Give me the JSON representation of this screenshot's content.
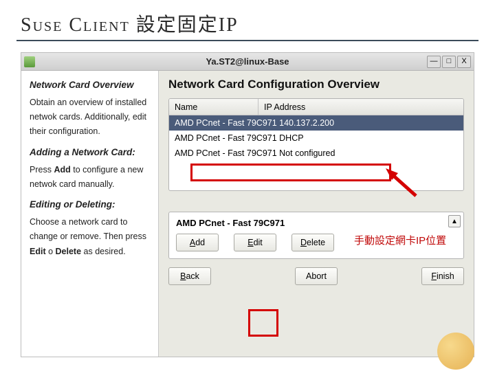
{
  "slide": {
    "title": "Suse Client 設定固定IP"
  },
  "window": {
    "title": "Ya.ST2@linux-Base",
    "controls": {
      "min": "—",
      "max": "□",
      "close": "X"
    }
  },
  "leftpane": {
    "h1": "Network Card Overview",
    "p1": "Obtain an overview of installed netwok cards. Additionally, edit their configuration.",
    "h2": "Adding a Network Card:",
    "p2a": "Press ",
    "p2b": "Add",
    "p2c": " to configure a new netwok card manually.",
    "h3": "Editing or Deleting:",
    "p3a": "Choose a network card to change or remove. Then press ",
    "p3b": "Edit",
    "p3c": " o ",
    "p3d": "Delete",
    "p3e": " as desired."
  },
  "rightpane": {
    "title": "Network Card Configuration Overview",
    "col_name": "Name",
    "col_ip": "IP Address",
    "rows": [
      {
        "text": "AMD PCnet - Fast 79C971  140.137.2.200"
      },
      {
        "text": "AMD PCnet - Fast 79C971  DHCP"
      },
      {
        "text": "AMD PCnet - Fast 79C971  Not configured"
      }
    ],
    "device": "AMD PCnet - Fast 79C971",
    "buttons": {
      "add": {
        "u": "A",
        "rest": "dd"
      },
      "edit": {
        "u": "E",
        "rest": "dit"
      },
      "delete": {
        "u": "D",
        "rest": "elete"
      },
      "back": {
        "u": "B",
        "rest": "ack"
      },
      "abort": {
        "u": "",
        "rest": "Abort"
      },
      "finish": {
        "u": "F",
        "rest": "inish"
      }
    }
  },
  "annotation": {
    "text": "手動設定網卡IP位置"
  }
}
